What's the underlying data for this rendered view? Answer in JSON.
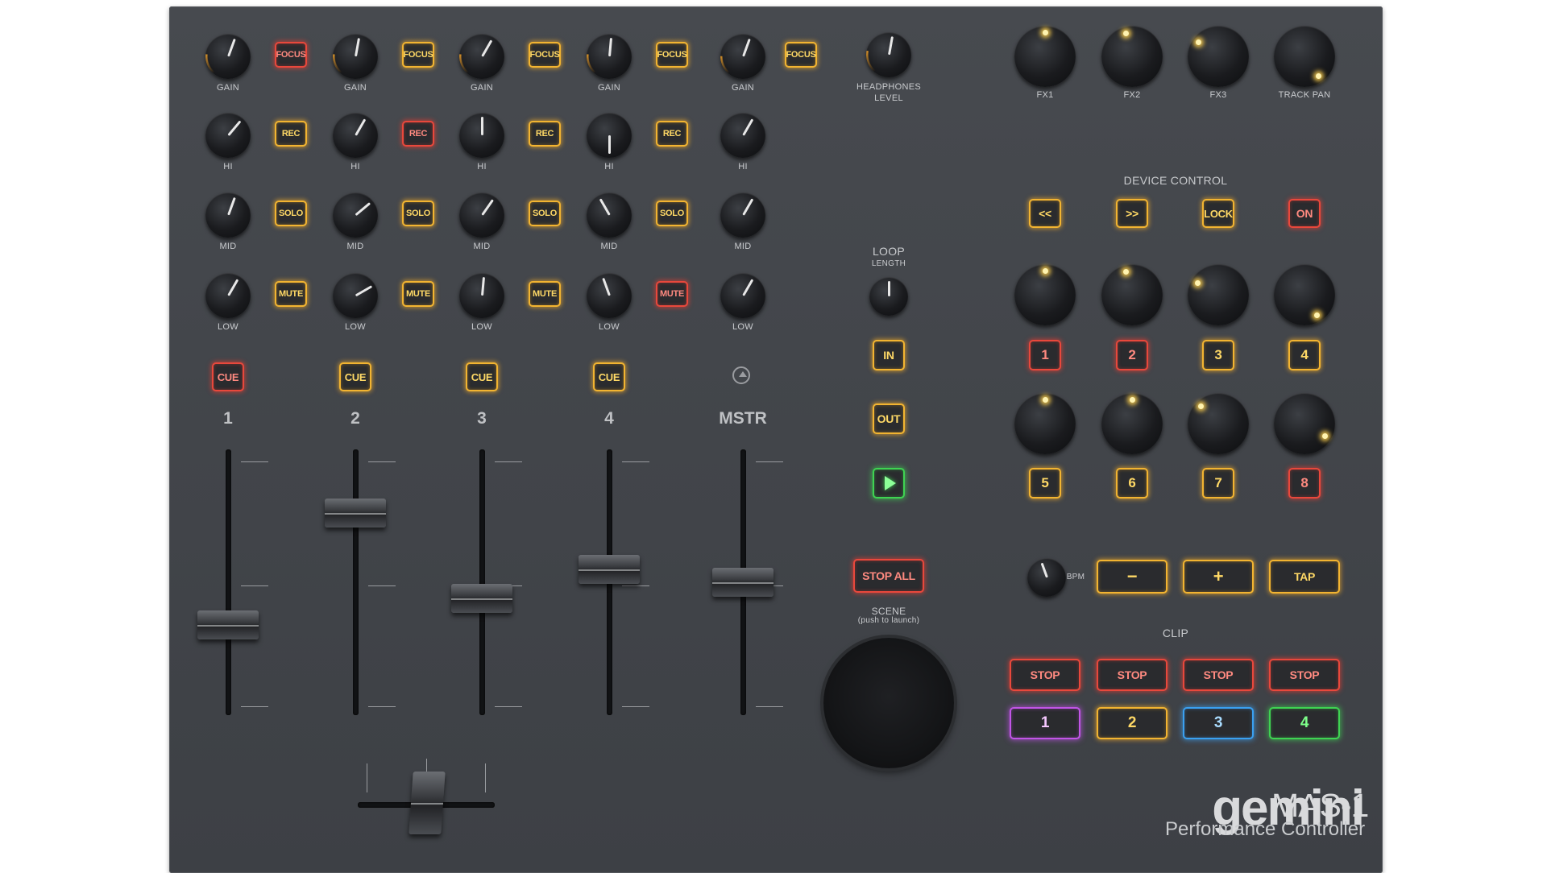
{
  "colors": {
    "panel": "#43464b",
    "amber": "#f2b431",
    "red": "#e8483c",
    "green": "#3fd352",
    "purple": "#c155e6",
    "blue": "#3aa0f0"
  },
  "channels": [
    {
      "number": "1",
      "gain": "GAIN",
      "hi": "HI",
      "mid": "MID",
      "low": "LOW",
      "focus": "FOCUS",
      "rec": "REC",
      "solo": "SOLO",
      "mute": "MUTE",
      "cue": "CUE",
      "fader_level": 0.34
    },
    {
      "number": "2",
      "gain": "GAIN",
      "hi": "HI",
      "mid": "MID",
      "low": "LOW",
      "focus": "FOCUS",
      "rec": "REC",
      "solo": "SOLO",
      "mute": "MUTE",
      "cue": "CUE",
      "fader_level": 0.76
    },
    {
      "number": "3",
      "gain": "GAIN",
      "hi": "HI",
      "mid": "MID",
      "low": "LOW",
      "focus": "FOCUS",
      "rec": "REC",
      "solo": "SOLO",
      "mute": "MUTE",
      "cue": "CUE",
      "fader_level": 0.44
    },
    {
      "number": "4",
      "gain": "GAIN",
      "hi": "HI",
      "mid": "MID",
      "low": "LOW",
      "focus": "FOCUS",
      "rec": "REC",
      "solo": "SOLO",
      "mute": "MUTE",
      "cue": "CUE",
      "fader_level": 0.55
    }
  ],
  "master": {
    "label": "MSTR",
    "gain": "GAIN",
    "hi": "HI",
    "mid": "MID",
    "low": "LOW",
    "focus": "FOCUS",
    "fader_level": 0.5
  },
  "headphones": {
    "line1": "HEADPHONES",
    "line2": "LEVEL"
  },
  "loop": {
    "title": "LOOP",
    "subtitle": "LENGTH",
    "in": "IN",
    "out": "OUT",
    "play_icon": "play-icon"
  },
  "stop_all": "STOP ALL",
  "scene": {
    "title": "SCENE",
    "subtitle": "(push to launch)"
  },
  "fx": [
    "FX1",
    "FX2",
    "FX3",
    "TRACK PAN"
  ],
  "device_control": {
    "title": "DEVICE CONTROL",
    "prev": "<<",
    "next": ">>",
    "lock": "LOCK",
    "on": "ON"
  },
  "device_buttons": [
    "1",
    "2",
    "3",
    "4",
    "5",
    "6",
    "7",
    "8"
  ],
  "bpm": {
    "label": "BPM",
    "minus": "−",
    "plus": "+",
    "tap": "TAP"
  },
  "clip": {
    "title": "CLIP",
    "stops": [
      "STOP",
      "STOP",
      "STOP",
      "STOP"
    ],
    "launch": [
      "1",
      "2",
      "3",
      "4"
    ]
  },
  "branding": {
    "brand": "gemini",
    "model": "MAS-1",
    "subtitle": "Performance Controller"
  }
}
